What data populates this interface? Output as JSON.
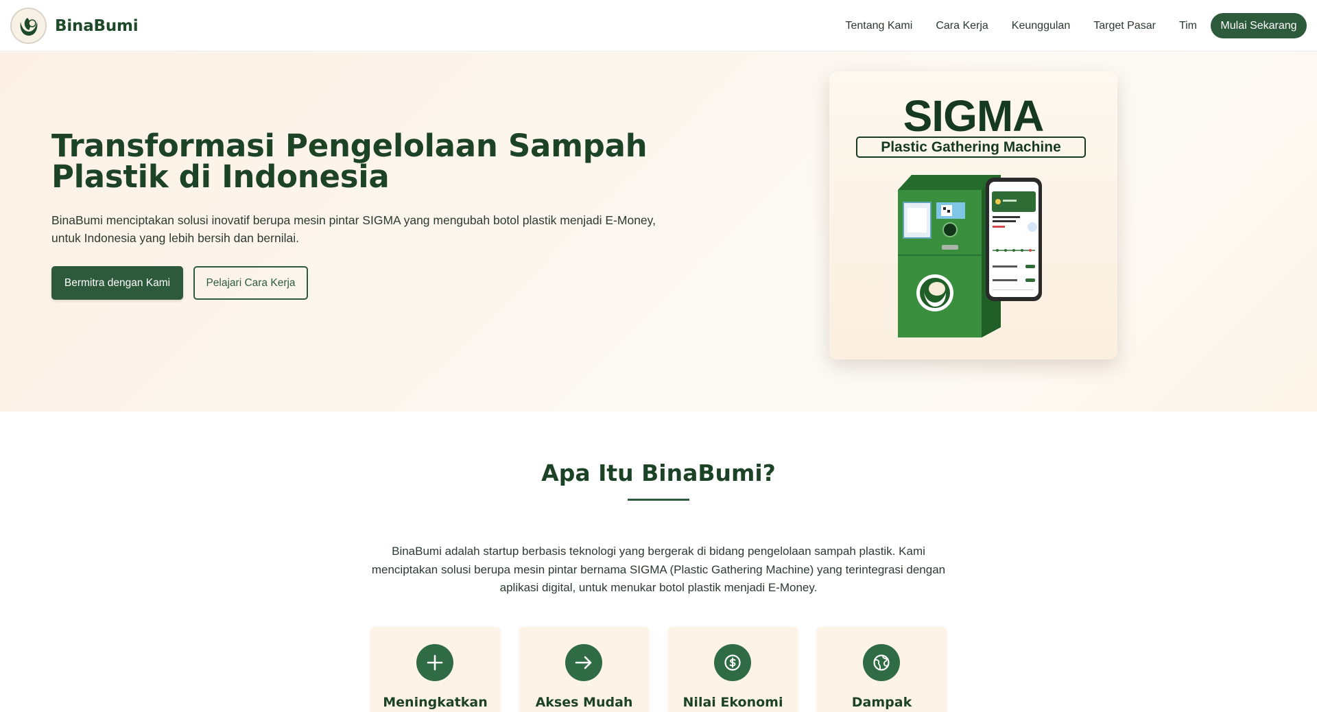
{
  "brand": {
    "name": "BinaBumi"
  },
  "nav": {
    "links": [
      "Tentang Kami",
      "Cara Kerja",
      "Keunggulan",
      "Target Pasar",
      "Tim"
    ],
    "cta": "Mulai Sekarang"
  },
  "hero": {
    "title": "Transformasi Pengelolaan Sampah Plastik di Indonesia",
    "description": "BinaBumi menciptakan solusi inovatif berupa mesin pintar SIGMA yang mengubah botol plastik menjadi E-Money, untuk Indonesia yang lebih bersih dan bernilai.",
    "primary_button": "Bermitra dengan Kami",
    "secondary_button": "Pelajari Cara Kerja",
    "product": {
      "title": "SIGMA",
      "subtitle": "Plastic Gathering Machine"
    }
  },
  "about": {
    "title": "Apa Itu BinaBumi?",
    "text": "BinaBumi adalah startup berbasis teknologi yang bergerak di bidang pengelolaan sampah plastik. Kami menciptakan solusi berupa mesin pintar bernama SIGMA (Plastic Gathering Machine) yang terintegrasi dengan aplikasi digital, untuk menukar botol plastik menjadi E-Money.",
    "features": [
      {
        "label": "Meningkatkan",
        "icon": "plus-icon"
      },
      {
        "label": "Akses Mudah",
        "icon": "arrow-right-icon"
      },
      {
        "label": "Nilai Ekonomi",
        "icon": "dollar-coin-icon"
      },
      {
        "label": "Dampak",
        "icon": "globe-icon"
      }
    ]
  },
  "colors": {
    "primary": "#2d5a3a",
    "heading": "#1d4326",
    "hero_bg": "#fcf3e8",
    "card_bg": "#fdf3e7"
  }
}
